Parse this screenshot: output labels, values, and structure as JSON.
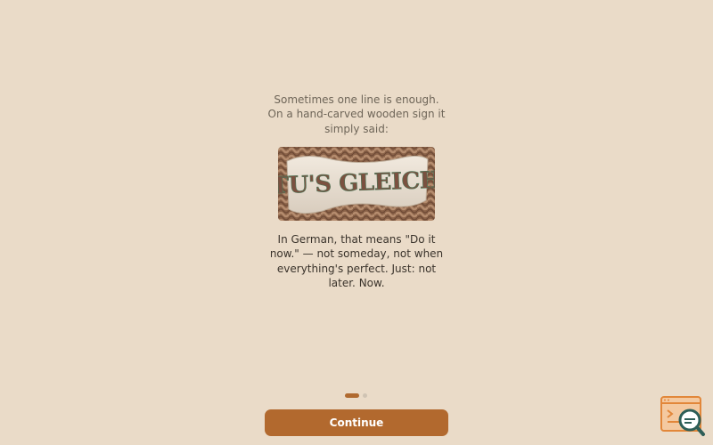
{
  "story": {
    "intro_text": "Sometimes one line is enough. On a hand-carved wooden sign it simply said:",
    "sign_text": "TU'S GLEICH",
    "explanation_text": "In German, that means \"Do it now.\" — not someday, not when everything's perfect. Just: not later. Now."
  },
  "pager": {
    "total_pages": 2,
    "current_page": 1
  },
  "actions": {
    "continue_label": "Continue"
  },
  "colors": {
    "background": "#EADBC8",
    "accent": "#B2692E",
    "dot_inactive": "#CFC3B3"
  },
  "icons": {
    "corner_badge": "browser-search-icon"
  }
}
